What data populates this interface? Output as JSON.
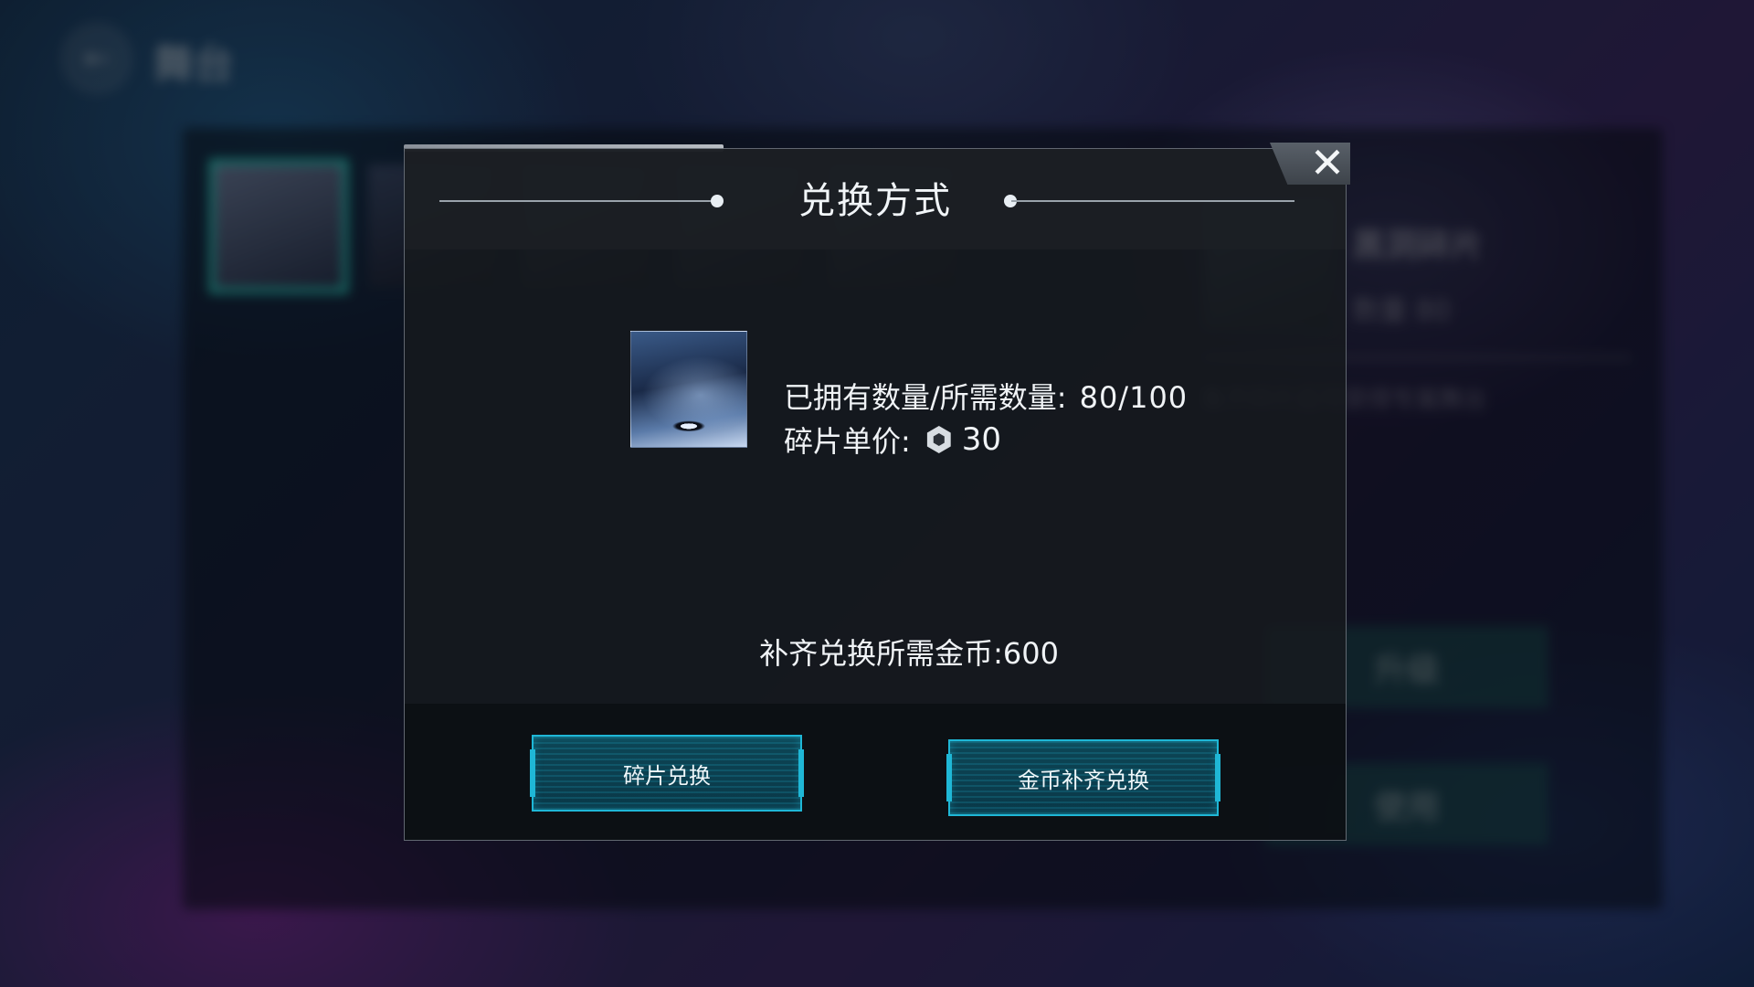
{
  "background": {
    "back_label": "舞台",
    "side_title": "黑洞碎片",
    "side_sub": "数量 80",
    "side_desc": "集齐碎片后可获得专属舞台",
    "side_btn_1": "升级",
    "side_btn_2": "使用"
  },
  "dialog": {
    "title": "兑换方式",
    "owned_label": "已拥有数量/所需数量:",
    "owned_value": "80/100",
    "price_label": "碎片单价:",
    "price_value": "30",
    "coin_cost": "补齐兑换所需金币:600",
    "shard_exchange_label": "碎片兑换",
    "coin_exchange_label": "金币补齐兑换",
    "close_icon": "close-icon",
    "shard_currency_icon": "hexagon-shard-icon"
  },
  "colors": {
    "button_border": "#1fb7d6",
    "button_fill": "#0d4656",
    "selected_thumb": "#2ccfc0"
  }
}
